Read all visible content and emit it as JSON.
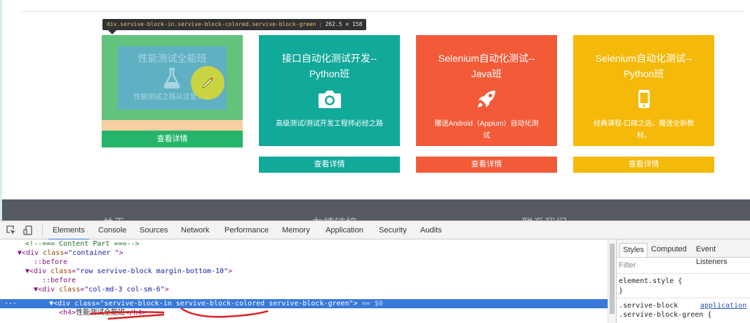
{
  "tooltip": {
    "selector": "div.servive-block-in.servive-block-colored.servive-block-green",
    "size": "262.5 × 158"
  },
  "colors": {
    "card_green_highlight": "#63c27c",
    "card_teal": "#11a99a",
    "card_orange": "#f25a38",
    "card_yellow": "#f5b90a",
    "footer": "#565a61",
    "devtools_accent": "#3879d9"
  },
  "cards": [
    {
      "title": "性能测试全能班",
      "icon": "flask-icon",
      "desc": "性能测试之路从这里开始",
      "button": "查看详情"
    },
    {
      "title": "接口自动化测试开发--Python班",
      "icon": "camera-icon",
      "desc": "高级测试/测试开发工程师必经之路",
      "button": "查看详情"
    },
    {
      "title": "Selenium自动化测试--Java班",
      "icon": "rocket-icon",
      "desc": "赠送Android（Appium）自动化测试",
      "button": "查看详情"
    },
    {
      "title": "Selenium自动化测试--Python班",
      "icon": "mobile-icon",
      "desc": "经典课程-口碑之选，赠送全新教材。",
      "button": "查看详情"
    }
  ],
  "footer_headings": [
    "关于",
    "友情链接",
    "联系我们"
  ],
  "devtools": {
    "tabs": [
      "Elements",
      "Console",
      "Sources",
      "Network",
      "Performance",
      "Memory",
      "Application",
      "Security",
      "Audits"
    ],
    "active_tab": "Elements",
    "tree": {
      "comment": "<!--=== Content Part ===-->",
      "container_tag": "div",
      "container_class": "container ",
      "before": "::before",
      "row_class": "row servive-block margin-bottom-10",
      "col_class": "col-md-3 col-sm-6",
      "selected_class": "servive-block-in servive-block-colored servive-block-green",
      "selected_suffix": "== $0",
      "h4_text": "性能测试全能班"
    },
    "styles_tabs": [
      "Styles",
      "Computed",
      "Event Listeners"
    ],
    "filter_placeholder": "Filter",
    "rules": {
      "element_style": "element.style {",
      "close_brace": "}",
      "selector_1": ".servive-block",
      "source_1": "application",
      "selector_2": ".servive-block-green {"
    }
  }
}
